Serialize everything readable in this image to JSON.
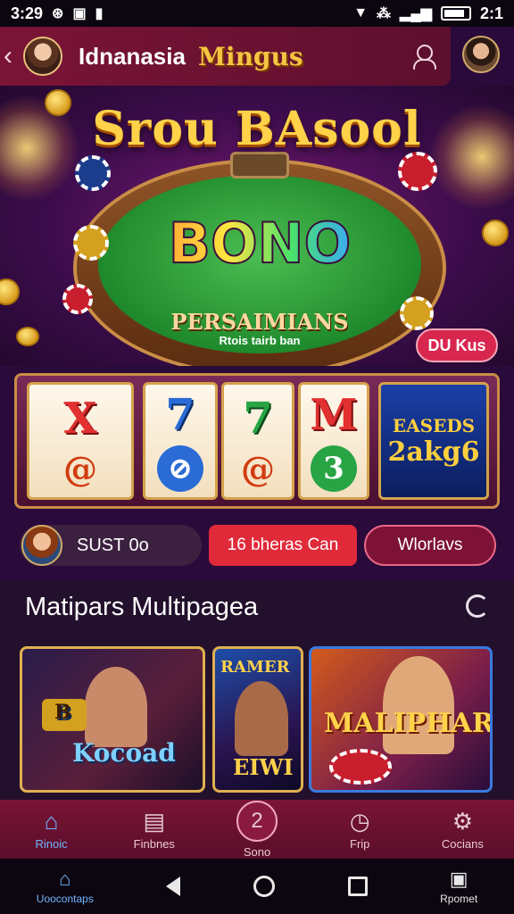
{
  "status_bar": {
    "time_left": "3:29",
    "time_right": "2:1",
    "icons_left": [
      "sync-icon",
      "image-icon",
      "bag-icon"
    ],
    "icons_right": [
      "location-icon",
      "network-icon",
      "signal-icon",
      "battery-icon"
    ]
  },
  "header": {
    "title": "Idnanasia",
    "brand": "Mingus"
  },
  "hero": {
    "title": "Srou BAsool",
    "table_word": "BONO",
    "table_line1": "PERSAIMIANS",
    "table_line2": "Rtois tairb ban",
    "bonus_button": "DU Kus"
  },
  "slots": {
    "reels": [
      {
        "top": "X",
        "bottom": "@"
      },
      {
        "top": "7",
        "bottom": "⊘"
      },
      {
        "top": "7",
        "bottom": "@"
      },
      {
        "top": "M",
        "bottom": "3"
      }
    ],
    "card_line1": "EASEDS",
    "card_line2": "2akg6"
  },
  "actions": {
    "user_text": "SUST 0o",
    "red_button": "16 bheras Can",
    "outline_button": "Wlorlavs"
  },
  "section": {
    "title": "Matipars Multipagea",
    "cards": [
      {
        "label": "Kocoad",
        "badge": "B"
      },
      {
        "label_top": "RAMER",
        "label_bottom": "EIWI"
      },
      {
        "label": "MALIPHARS"
      }
    ]
  },
  "bottom_nav": {
    "items": [
      {
        "label": "Rinoic",
        "icon": "home-icon"
      },
      {
        "label": "Finbnes",
        "icon": "receipt-icon"
      },
      {
        "label": "Sono",
        "icon": "spin-icon",
        "glyph": "2"
      },
      {
        "label": "Frip",
        "icon": "clock-icon"
      },
      {
        "label": "Cocians",
        "icon": "gear-icon"
      }
    ]
  },
  "system_nav": {
    "left_label": "Uoocontaps",
    "right_label": "Rpomet"
  },
  "colors": {
    "accent_gold": "#f5c542",
    "header_maroon": "#7b1436",
    "active_blue": "#6fb6ff",
    "red_button": "#e02a3a"
  }
}
